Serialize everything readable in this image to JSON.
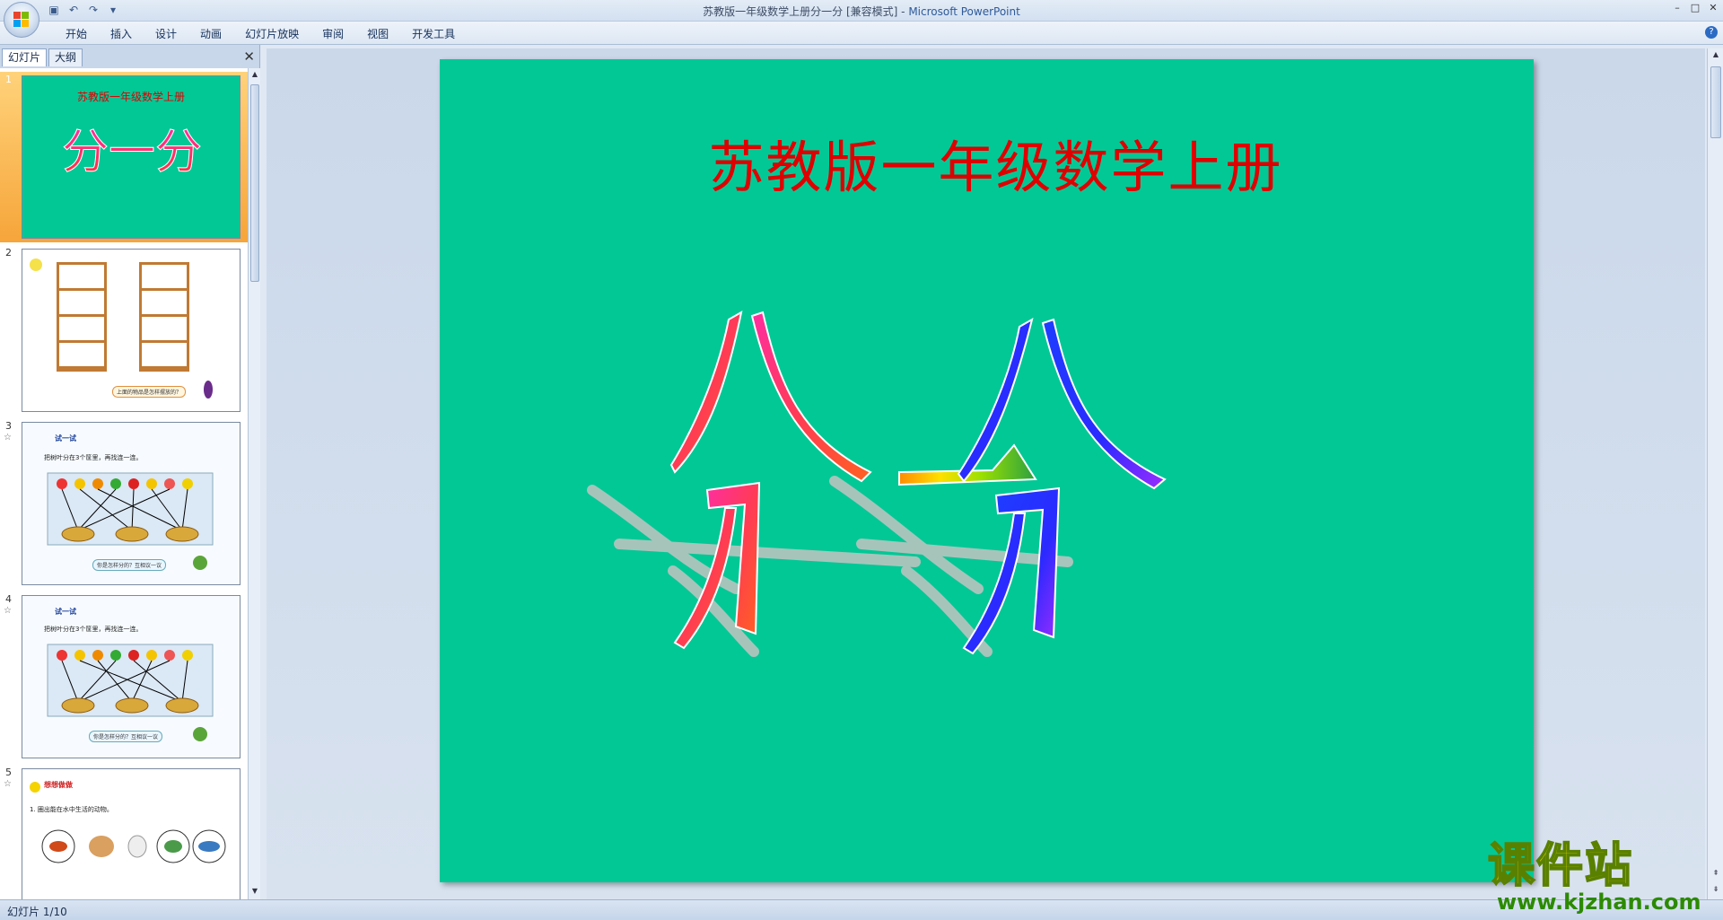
{
  "window": {
    "title_doc": "苏教版一年级数学上册分一分 [兼容模式] - ",
    "title_app": "Microsoft PowerPoint",
    "controls": [
      "–",
      "□",
      "✕"
    ]
  },
  "quick_access": {
    "save_icon": "save-icon",
    "undo_icon": "undo-icon",
    "redo_icon": "redo-icon",
    "customize_icon": "dropdown-icon"
  },
  "ribbon": {
    "tabs": [
      "开始",
      "插入",
      "设计",
      "动画",
      "幻灯片放映",
      "审阅",
      "视图",
      "开发工具"
    ],
    "help": "?"
  },
  "left_pane": {
    "tab_slides": "幻灯片",
    "tab_outline": "大纲",
    "close": "✕",
    "thumbnails": [
      {
        "num": "1",
        "title": "苏教版一年级数学上册",
        "main": "分一分"
      },
      {
        "num": "2",
        "caption": "上面的物品是怎样摆放的？"
      },
      {
        "num": "3",
        "heading": "试一试",
        "line": "把树叶分在3个筐里，再找连一连。",
        "caption": "你是怎样分的？互相议一议"
      },
      {
        "num": "4",
        "heading": "试一试",
        "line": "把树叶分在3个筐里，再找连一连。",
        "caption": "你是怎样分的？互相议一议"
      },
      {
        "num": "5",
        "heading": "想想做做",
        "line": "1. 圈出能在水中生活的动物。"
      }
    ]
  },
  "slide": {
    "title": "苏教版一年级数学上册",
    "wordart": "分一分"
  },
  "status": {
    "slide_indicator": "幻灯片 1/10"
  },
  "watermark": {
    "cn": "课件站",
    "url": "www.kjzhan.com"
  },
  "colors": {
    "slide_bg": "#02c896",
    "title_red": "#e00000",
    "selection_orange": "#f6a53a"
  }
}
